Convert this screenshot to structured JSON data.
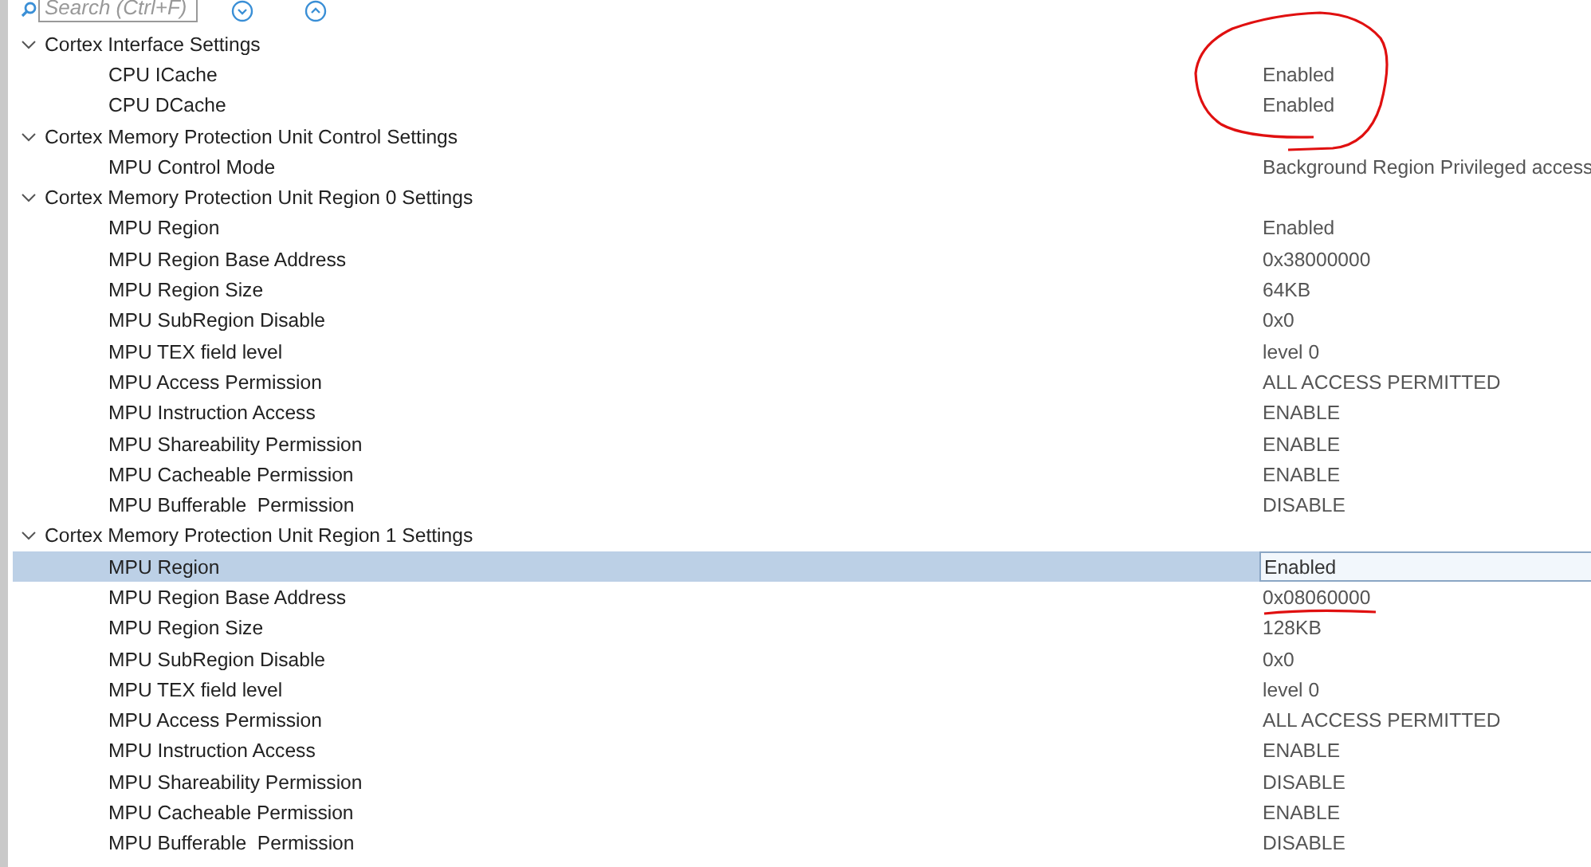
{
  "search": {
    "placeholder": "Search (Ctrl+F)"
  },
  "groups": [
    {
      "label": "Cortex Interface Settings",
      "expanded": true,
      "circled": true,
      "rows": [
        {
          "label": "CPU ICache",
          "value": "Enabled",
          "selected": false
        },
        {
          "label": "CPU DCache",
          "value": "Enabled",
          "selected": false
        }
      ]
    },
    {
      "label": "Cortex Memory Protection Unit Control Settings",
      "expanded": true,
      "rows": [
        {
          "label": "MPU Control Mode",
          "value": "Background Region Privileged access",
          "selected": false
        }
      ]
    },
    {
      "label": "Cortex Memory Protection Unit Region 0 Settings",
      "expanded": true,
      "rows": [
        {
          "label": "MPU Region",
          "value": "Enabled",
          "selected": false
        },
        {
          "label": "MPU Region Base Address",
          "value": "0x38000000",
          "selected": false
        },
        {
          "label": "MPU Region Size",
          "value": "64KB",
          "selected": false
        },
        {
          "label": "MPU SubRegion Disable",
          "value": "0x0",
          "selected": false
        },
        {
          "label": "MPU TEX field level",
          "value": "level 0",
          "selected": false
        },
        {
          "label": "MPU Access Permission",
          "value": "ALL ACCESS PERMITTED",
          "selected": false
        },
        {
          "label": "MPU Instruction Access",
          "value": "ENABLE",
          "selected": false
        },
        {
          "label": "MPU Shareability Permission",
          "value": "ENABLE",
          "selected": false
        },
        {
          "label": "MPU Cacheable Permission",
          "value": "ENABLE",
          "selected": false
        },
        {
          "label": "MPU Bufferable  Permission",
          "value": "DISABLE",
          "selected": false
        }
      ]
    },
    {
      "label": "Cortex Memory Protection Unit Region 1 Settings",
      "expanded": true,
      "rows": [
        {
          "label": "MPU Region",
          "value": "Enabled",
          "selected": true
        },
        {
          "label": "MPU Region Base Address",
          "value": "0x08060000",
          "selected": false,
          "underlined": true
        },
        {
          "label": "MPU Region Size",
          "value": "128KB",
          "selected": false
        },
        {
          "label": "MPU SubRegion Disable",
          "value": "0x0",
          "selected": false
        },
        {
          "label": "MPU TEX field level",
          "value": "level 0",
          "selected": false
        },
        {
          "label": "MPU Access Permission",
          "value": "ALL ACCESS PERMITTED",
          "selected": false
        },
        {
          "label": "MPU Instruction Access",
          "value": "ENABLE",
          "selected": false
        },
        {
          "label": "MPU Shareability Permission",
          "value": "DISABLE",
          "selected": false
        },
        {
          "label": "MPU Cacheable Permission",
          "value": "ENABLE",
          "selected": false
        },
        {
          "label": "MPU Bufferable  Permission",
          "value": "DISABLE",
          "selected": false
        }
      ]
    }
  ]
}
